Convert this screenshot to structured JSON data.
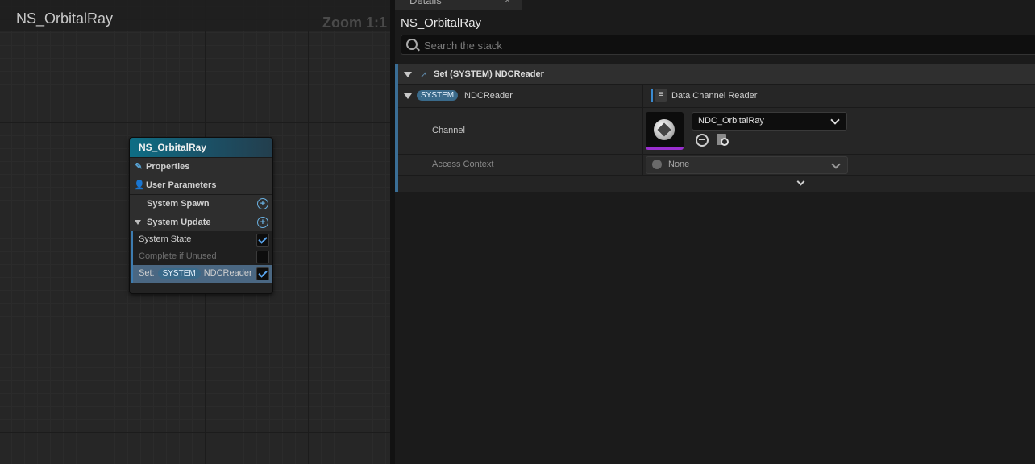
{
  "graph": {
    "title": "NS_OrbitalRay",
    "zoom": "Zoom 1:1",
    "node": {
      "title": "NS_OrbitalRay",
      "properties": "Properties",
      "user_parameters": "User Parameters",
      "system_spawn": "System Spawn",
      "system_update": "System Update",
      "modules": [
        {
          "label": "System State",
          "enabled": true
        },
        {
          "label": "Complete if Unused",
          "enabled": false
        }
      ],
      "set_prefix": "Set:",
      "set_badge": "SYSTEM",
      "set_name": "NDCReader"
    }
  },
  "details": {
    "tab_label": "Details",
    "tab_close": "×",
    "title": "NS_OrbitalRay",
    "search_placeholder": "Search the stack",
    "set_row_label": "Set (SYSTEM) NDCReader",
    "param": {
      "badge": "SYSTEM",
      "name": "NDCReader",
      "type": "Data Channel Reader"
    },
    "channel": {
      "label": "Channel",
      "value": "NDC_OrbitalRay"
    },
    "access_context": {
      "label": "Access Context",
      "value": "None"
    }
  },
  "colors": {
    "accent": "#3a6e96",
    "node_header": "#0e6e85",
    "thumbnail_underline": "#9a2fd0",
    "checkbox_check": "#5aa6f0"
  }
}
